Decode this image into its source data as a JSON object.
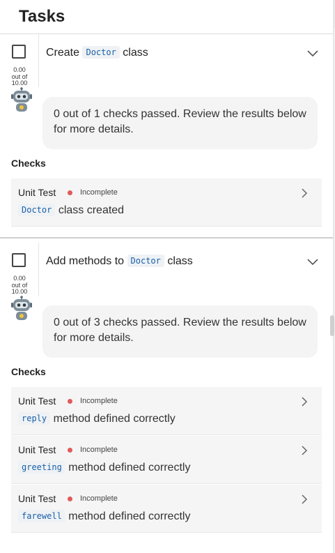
{
  "header": {
    "title": "Tasks"
  },
  "tasks": [
    {
      "title_prefix": "Create",
      "title_code": "Doctor",
      "title_suffix": "class",
      "score_value": "0.00",
      "score_out_of": "out of",
      "score_max": "10.00",
      "summary": "0 out of 1 checks passed. Review the results below for more details.",
      "checks_label": "Checks",
      "checks": [
        {
          "type": "Unit Test",
          "status": "Incomplete",
          "code": "Doctor",
          "text": "class created"
        }
      ]
    },
    {
      "title_prefix": "Add methods to",
      "title_code": "Doctor",
      "title_suffix": "class",
      "score_value": "0.00",
      "score_out_of": "out of",
      "score_max": "10.00",
      "summary": "0 out of 3 checks passed. Review the results below for more details.",
      "checks_label": "Checks",
      "checks": [
        {
          "type": "Unit Test",
          "status": "Incomplete",
          "code": "reply",
          "text": "method defined correctly"
        },
        {
          "type": "Unit Test",
          "status": "Incomplete",
          "code": "greeting",
          "text": "method defined correctly"
        },
        {
          "type": "Unit Test",
          "status": "Incomplete",
          "code": "farewell",
          "text": "method defined correctly"
        }
      ]
    }
  ],
  "icons": {
    "status_dot_color": "#e05a5a",
    "code_color": "#1a5fa8",
    "expand": "chevron-down-icon",
    "open_check": "chevron-right-icon",
    "assistant": "robot-icon"
  }
}
